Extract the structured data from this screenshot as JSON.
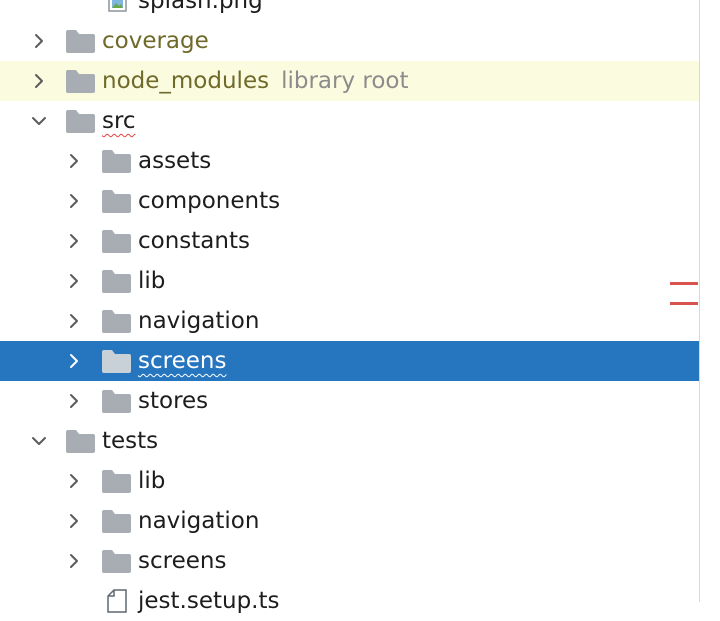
{
  "colors": {
    "selection": "#2675bf",
    "library_highlight": "#fbfbe0",
    "folder_icon": "#a7adb3",
    "excluded_text": "#6f6a2a",
    "library_suffix": "#8c8c8c",
    "error_marker": "#d9534f"
  },
  "tree": [
    {
      "label": "splash.png",
      "depth": 1,
      "chevron": "none",
      "icon": "image-file-icon",
      "partial": true
    },
    {
      "label": "coverage",
      "depth": 0,
      "chevron": "collapsed",
      "icon": "folder-icon",
      "style": "olive"
    },
    {
      "label": "node_modules",
      "suffix": "library root",
      "depth": 0,
      "chevron": "collapsed",
      "icon": "folder-icon",
      "style": "olive",
      "highlight": true
    },
    {
      "label": "src",
      "depth": 0,
      "chevron": "expanded",
      "icon": "folder-icon",
      "squiggle": true
    },
    {
      "label": "assets",
      "depth": 1,
      "chevron": "collapsed",
      "icon": "folder-icon"
    },
    {
      "label": "components",
      "depth": 1,
      "chevron": "collapsed",
      "icon": "folder-icon"
    },
    {
      "label": "constants",
      "depth": 1,
      "chevron": "collapsed",
      "icon": "folder-icon"
    },
    {
      "label": "lib",
      "depth": 1,
      "chevron": "collapsed",
      "icon": "folder-icon"
    },
    {
      "label": "navigation",
      "depth": 1,
      "chevron": "collapsed",
      "icon": "folder-icon"
    },
    {
      "label": "screens",
      "depth": 1,
      "chevron": "collapsed",
      "icon": "folder-icon",
      "selected": true,
      "squiggle": true
    },
    {
      "label": "stores",
      "depth": 1,
      "chevron": "collapsed",
      "icon": "folder-icon"
    },
    {
      "label": "tests",
      "depth": 0,
      "chevron": "expanded",
      "icon": "folder-icon"
    },
    {
      "label": "lib",
      "depth": 1,
      "chevron": "collapsed",
      "icon": "folder-icon"
    },
    {
      "label": "navigation",
      "depth": 1,
      "chevron": "collapsed",
      "icon": "folder-icon"
    },
    {
      "label": "screens",
      "depth": 1,
      "chevron": "collapsed",
      "icon": "folder-icon"
    },
    {
      "label": "jest.setup.ts",
      "depth": 1,
      "chevron": "none",
      "icon": "text-file-icon",
      "partial": true
    }
  ]
}
